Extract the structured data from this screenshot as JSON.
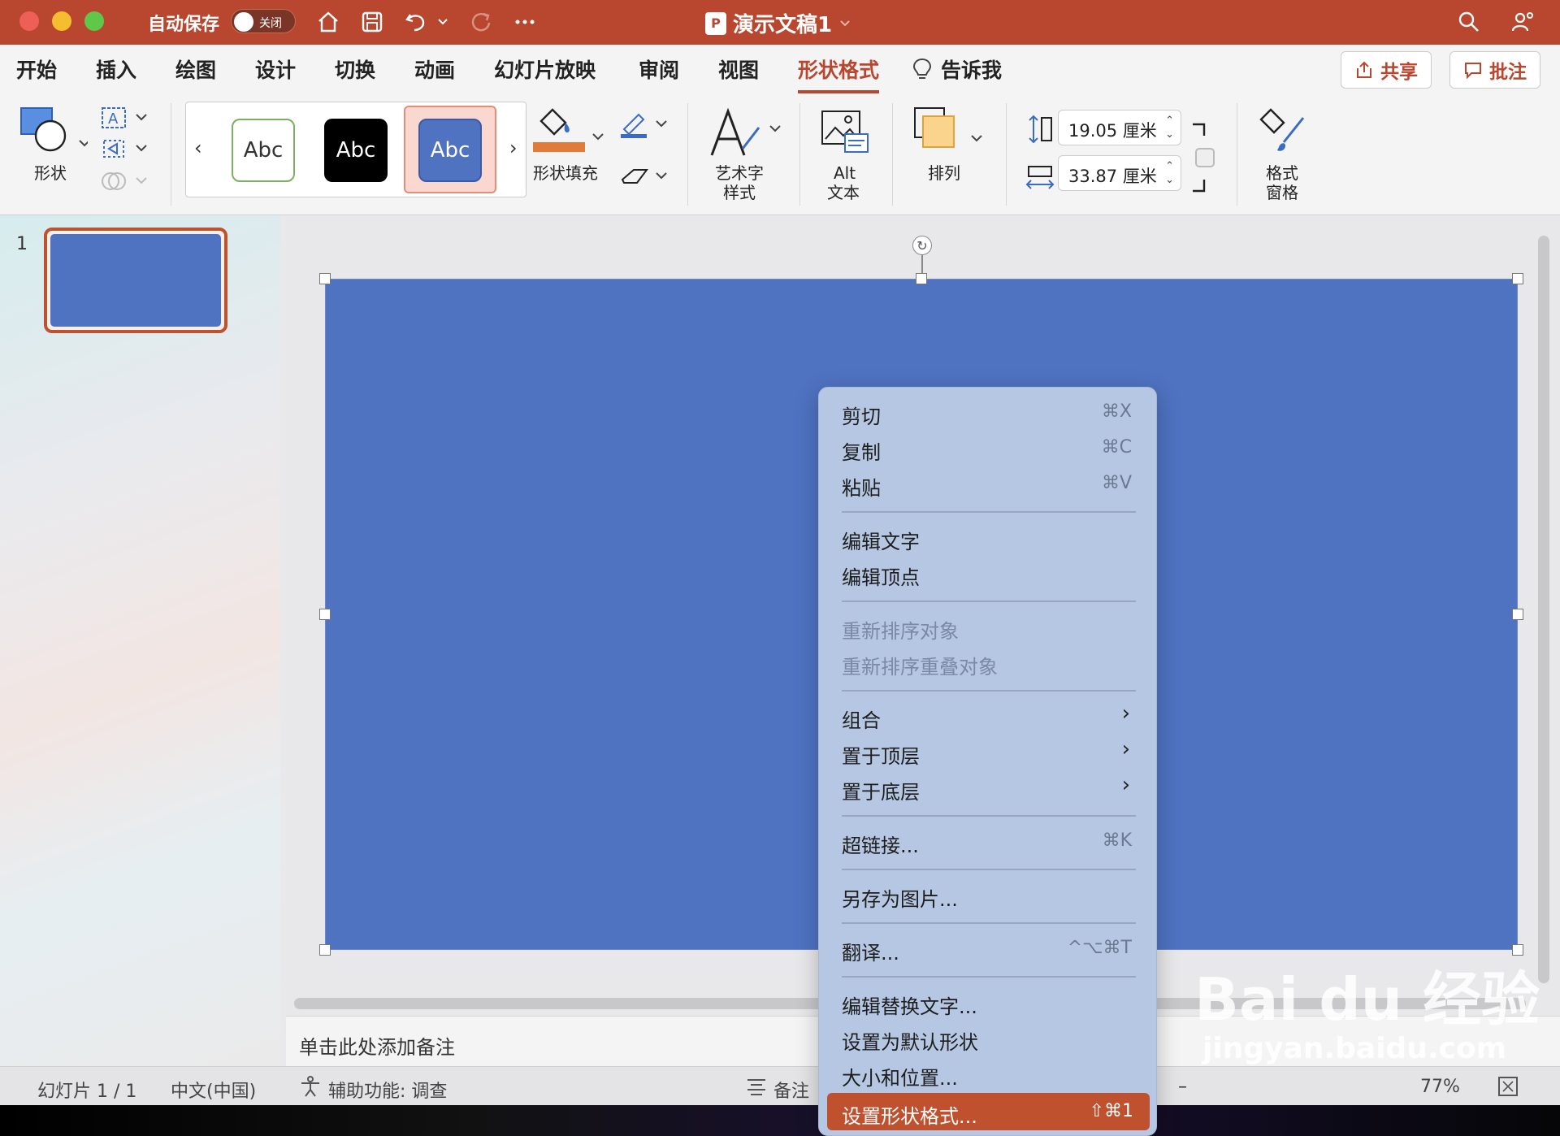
{
  "titlebar": {
    "autosave_label": "自动保存",
    "autosave_state": "关闭",
    "doc_title": "演示文稿1",
    "doc_badge": "P"
  },
  "tabs": [
    "开始",
    "插入",
    "绘图",
    "设计",
    "切换",
    "动画",
    "幻灯片放映",
    "审阅",
    "视图",
    "形状格式"
  ],
  "tell_me": "告诉我",
  "actions": {
    "share": "共享",
    "comment": "批注"
  },
  "ribbon": {
    "shape_label": "形状",
    "style_samples": [
      "Abc",
      "Abc",
      "Abc"
    ],
    "fill_label": "形状填充",
    "wordart_label_1": "艺术字",
    "wordart_label_2": "样式",
    "alt_label_1": "Alt",
    "alt_label_2": "文本",
    "arrange_label": "排列",
    "height_value": "19.05 厘米",
    "width_value": "33.87 厘米",
    "format_pane_label_1": "格式",
    "format_pane_label_2": "窗格",
    "fill_color": "#e07b39"
  },
  "slides_panel": {
    "slide_number": "1"
  },
  "notes_placeholder": "单击此处添加备注",
  "status": {
    "slide_info": "幻灯片 1 / 1",
    "language": "中文(中国)",
    "accessibility": "辅助功能: 调查",
    "notes_label": "备注",
    "zoom": "77%"
  },
  "colors": {
    "accent": "#b9472f",
    "slide_fill": "#4f72c1",
    "menu_bg": "#b6c7e3",
    "highlight": "#c0512f"
  },
  "context_menu": {
    "cut": {
      "label": "剪切",
      "shortcut": "⌘X"
    },
    "copy": {
      "label": "复制",
      "shortcut": "⌘C"
    },
    "paste": {
      "label": "粘贴",
      "shortcut": "⌘V"
    },
    "edit_text": "编辑文字",
    "edit_points": "编辑顶点",
    "reorder_objects": "重新排序对象",
    "reorder_overlap": "重新排序重叠对象",
    "group": "组合",
    "bring_to_front": "置于顶层",
    "send_to_back": "置于底层",
    "hyperlink": {
      "label": "超链接...",
      "shortcut": "⌘K"
    },
    "save_as_picture": "另存为图片...",
    "translate": {
      "label": "翻译...",
      "shortcut": "^⌥⌘T"
    },
    "edit_alt_text": "编辑替换文字...",
    "set_default_shape": "设置为默认形状",
    "size_position": "大小和位置...",
    "format_shape": {
      "label": "设置形状格式...",
      "shortcut": "⇧⌘1"
    }
  },
  "watermark": {
    "brand": "Bai du 经验",
    "url": "jingyan.baidu.com"
  }
}
